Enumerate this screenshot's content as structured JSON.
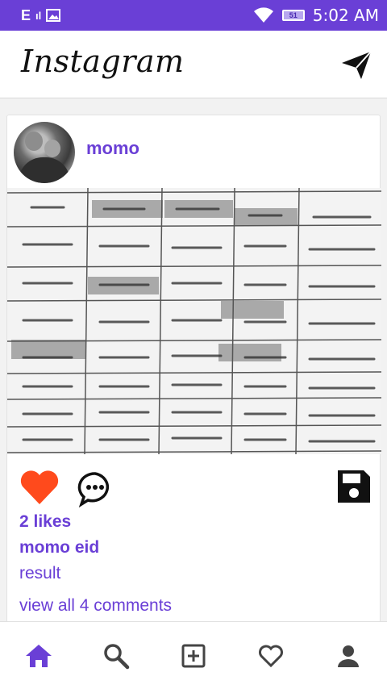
{
  "status_bar": {
    "left_text": "E",
    "signal_text": "ıl",
    "battery_level": "51",
    "time": "5:02 AM"
  },
  "app": {
    "title": "Instagram"
  },
  "post": {
    "username": "momo",
    "likes": "2 likes",
    "caption_user": "momo eid",
    "caption_text": "result",
    "view_comments": "view all 4 comments"
  },
  "colors": {
    "accent": "#6a3fd6",
    "like": "#ff4a1c",
    "icon": "#444444"
  },
  "icons": {
    "send": "send-icon",
    "like": "heart-icon",
    "comment": "comment-icon",
    "save": "save-icon",
    "nav": [
      "home-icon",
      "search-icon",
      "add-post-icon",
      "activity-heart-icon",
      "profile-icon"
    ]
  }
}
